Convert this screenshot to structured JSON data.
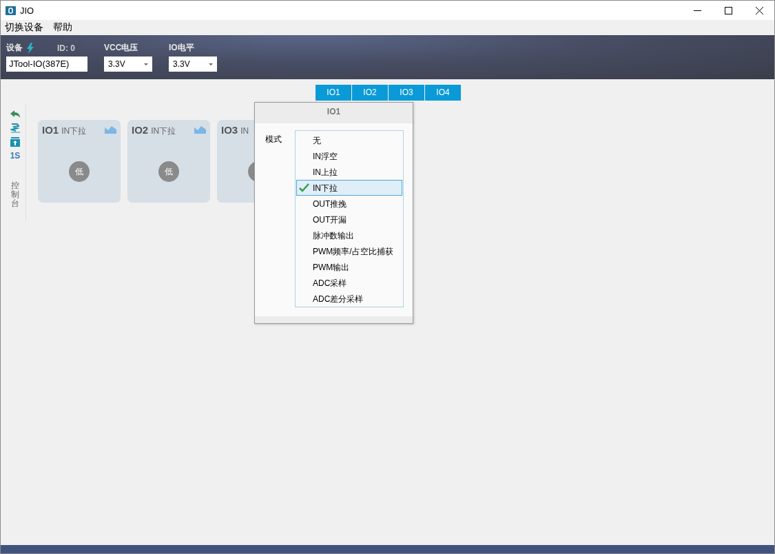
{
  "window": {
    "title": "JIO"
  },
  "menu": [
    "切换设备",
    "帮助"
  ],
  "header": {
    "device_label": "设备",
    "id": "ID: 0",
    "device_value": "JTool-IO(387E)",
    "vcc_label": "VCC电压",
    "vcc_value": "3.3V",
    "io_label": "IO电平",
    "io_value": "3.3V"
  },
  "side_toolbar": {
    "interval": "1S",
    "console": "控制台"
  },
  "cards": [
    {
      "name": "IO1",
      "mode": "IN下拉",
      "level": "低"
    },
    {
      "name": "IO2",
      "mode": "IN下拉",
      "level": "低"
    },
    {
      "name": "IO3",
      "mode": "IN"
    }
  ],
  "tabs": [
    "IO1",
    "IO2",
    "IO3",
    "IO4"
  ],
  "popup": {
    "title": "IO1",
    "field_label": "模式",
    "options": [
      {
        "label": "无",
        "selected": false
      },
      {
        "label": "IN浮空",
        "selected": false
      },
      {
        "label": "IN上拉",
        "selected": false
      },
      {
        "label": "IN下拉",
        "selected": true
      },
      {
        "label": "OUT推挽",
        "selected": false
      },
      {
        "label": "OUT开漏",
        "selected": false
      },
      {
        "label": "脉冲数输出",
        "selected": false
      },
      {
        "label": "PWM频率/占空比捕获",
        "selected": false
      },
      {
        "label": "PWM输出",
        "selected": false
      },
      {
        "label": "ADC采样",
        "selected": false
      },
      {
        "label": "ADC差分采样",
        "selected": false
      }
    ]
  }
}
